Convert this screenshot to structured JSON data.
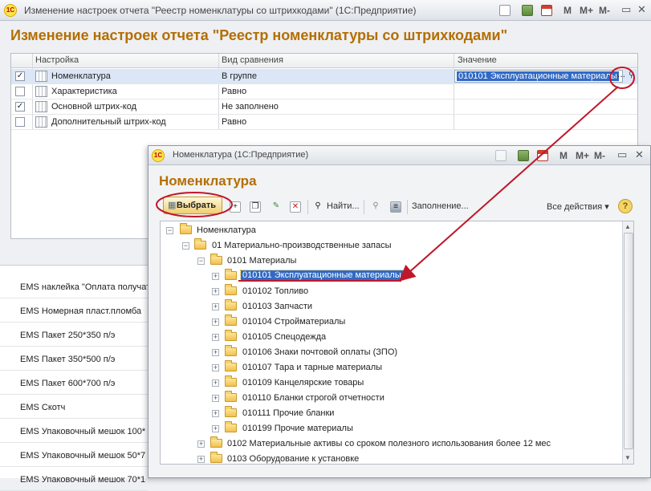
{
  "outer": {
    "logo": "1С",
    "title": "Изменение настроек отчета \"Реестр номенклатуры со штрихкодами\" (1С:Предприятие)",
    "m": "M",
    "mplus": "M+",
    "mminus": "M-",
    "heading": "Изменение настроек отчета \"Реестр номенклатуры со штрихкодами\""
  },
  "table": {
    "headers": [
      "Настройка",
      "Вид сравнения",
      "Значение"
    ],
    "rows": [
      {
        "checked": true,
        "setting": "Номенклатура",
        "comparison": "В группе",
        "value": "010101 Эксплуатационные материалы"
      },
      {
        "checked": false,
        "setting": "Характеристика",
        "comparison": "Равно",
        "value": ""
      },
      {
        "checked": true,
        "setting": "Основной штрих-код",
        "comparison": "Не заполнено",
        "value": ""
      },
      {
        "checked": false,
        "setting": "Дополнительный штрих-код",
        "comparison": "Равно",
        "value": ""
      }
    ],
    "dots": "...",
    "check_mark": "✓"
  },
  "background_list": [
    "EMS наклейка \"Оплата получат",
    "EMS Номерная пласт.пломба",
    "EMS Пакет 250*350 п/э",
    "EMS Пакет 350*500 п/э",
    "EMS Пакет 600*700 п/э",
    "EMS Скотч",
    "EMS Упаковочный мешок 100*",
    "EMS Упаковочный мешок 50*7",
    "EMS Упаковочный мешок 70*1"
  ],
  "inner": {
    "logo": "1С",
    "title": "Номенклатура (1С:Предприятие)",
    "m": "M",
    "mplus": "M+",
    "mminus": "M-",
    "heading": "Номенклатура",
    "select_label": "Выбрать",
    "find_label": "Найти...",
    "fill_label": "Заполнение...",
    "all_actions_label": "Все действия ▾",
    "help": "?"
  },
  "tree": [
    {
      "level": 0,
      "label": "Номенклатура",
      "expand": "−",
      "selected": false
    },
    {
      "level": 1,
      "label": "01 Материально-производственные запасы",
      "expand": "−",
      "selected": false
    },
    {
      "level": 2,
      "label": "0101 Материалы",
      "expand": "−",
      "selected": false
    },
    {
      "level": 3,
      "label": "010101 Эксплуатационные материалы",
      "expand": "+",
      "selected": true
    },
    {
      "level": 3,
      "label": "010102 Топливо",
      "expand": "+",
      "selected": false
    },
    {
      "level": 3,
      "label": "010103 Запчасти",
      "expand": "+",
      "selected": false
    },
    {
      "level": 3,
      "label": "010104 Стройматериалы",
      "expand": "+",
      "selected": false
    },
    {
      "level": 3,
      "label": "010105 Спецодежда",
      "expand": "+",
      "selected": false
    },
    {
      "level": 3,
      "label": "010106 Знаки почтовой оплаты (ЗПО)",
      "expand": "+",
      "selected": false
    },
    {
      "level": 3,
      "label": "010107 Тара и тарные материалы",
      "expand": "+",
      "selected": false
    },
    {
      "level": 3,
      "label": "010109 Канцелярские товары",
      "expand": "+",
      "selected": false
    },
    {
      "level": 3,
      "label": "010110 Бланки строгой отчетности",
      "expand": "+",
      "selected": false
    },
    {
      "level": 3,
      "label": "010111 Прочие бланки",
      "expand": "+",
      "selected": false
    },
    {
      "level": 3,
      "label": "010199 Прочие материалы",
      "expand": "+",
      "selected": false
    },
    {
      "level": 2,
      "label": "0102 Материальные активы со сроком полезного использования более 12 мес",
      "expand": "+",
      "selected": false
    },
    {
      "level": 2,
      "label": "0103 Оборудование к установке",
      "expand": "+",
      "selected": false
    }
  ],
  "colors": {
    "accent_heading": "#b46e00",
    "selection": "#316ac5",
    "annotation": "#c0182a"
  }
}
